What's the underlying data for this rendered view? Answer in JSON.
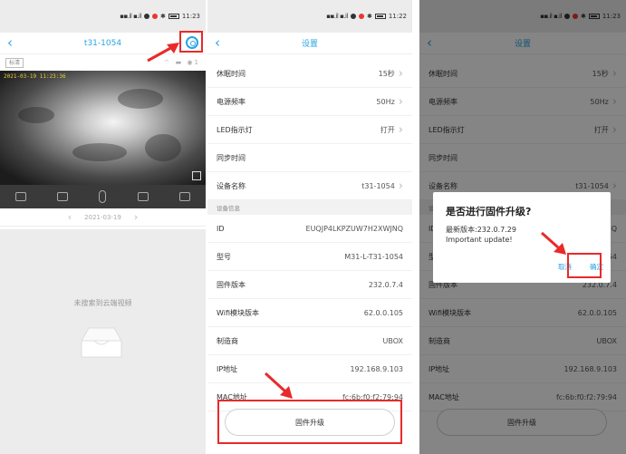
{
  "status": {
    "time": "11:23",
    "time_s2": "11:22"
  },
  "screen1": {
    "nav_title": "t31-1054",
    "quality_tag": "标清",
    "viewer_count": "1",
    "video_timestamp": "2021-03-19 11:23:36",
    "date": "2021-03-19",
    "empty_message": "未搜索到云端视频"
  },
  "settings": {
    "nav_title": "设置",
    "rows": [
      {
        "label": "休眠时间",
        "value": "15秒"
      },
      {
        "label": "电源频率",
        "value": "50Hz"
      },
      {
        "label": "LED指示灯",
        "value": "打开"
      },
      {
        "label": "同步时间",
        "value": ""
      },
      {
        "label": "设备名称",
        "value": "t31-1054"
      }
    ],
    "section_header": "设备信息",
    "info": [
      {
        "label": "ID",
        "value": "EUQJP4LKPZUW7H2XWJNQ"
      },
      {
        "label": "型号",
        "value": "M31-L-T31-1054"
      },
      {
        "label": "固件版本",
        "value": "232.0.7.4"
      },
      {
        "label": "Wifi模块版本",
        "value": "62.0.0.105"
      },
      {
        "label": "制造商",
        "value": "UBOX"
      },
      {
        "label": "IP地址",
        "value": "192.168.9.103"
      },
      {
        "label": "MAC地址",
        "value": "fc:6b:f0:f2:79:94"
      }
    ],
    "upgrade_button": "固件升级"
  },
  "dialog": {
    "title": "是否进行固件升级?",
    "line1": "最新版本:232.0.7.29",
    "line2": "Important update!",
    "cancel": "取消",
    "confirm": "确定"
  },
  "colors": {
    "accent": "#29a3e6",
    "highlight": "#e82a2a"
  }
}
